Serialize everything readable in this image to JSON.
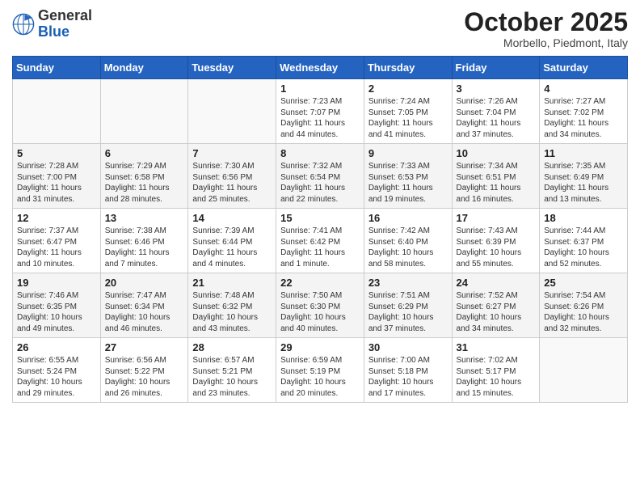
{
  "header": {
    "logo": {
      "general": "General",
      "blue": "Blue"
    },
    "title": "October 2025",
    "location": "Morbello, Piedmont, Italy"
  },
  "weekdays": [
    "Sunday",
    "Monday",
    "Tuesday",
    "Wednesday",
    "Thursday",
    "Friday",
    "Saturday"
  ],
  "weeks": [
    [
      {
        "day": "",
        "info": ""
      },
      {
        "day": "",
        "info": ""
      },
      {
        "day": "",
        "info": ""
      },
      {
        "day": "1",
        "info": "Sunrise: 7:23 AM\nSunset: 7:07 PM\nDaylight: 11 hours\nand 44 minutes."
      },
      {
        "day": "2",
        "info": "Sunrise: 7:24 AM\nSunset: 7:05 PM\nDaylight: 11 hours\nand 41 minutes."
      },
      {
        "day": "3",
        "info": "Sunrise: 7:26 AM\nSunset: 7:04 PM\nDaylight: 11 hours\nand 37 minutes."
      },
      {
        "day": "4",
        "info": "Sunrise: 7:27 AM\nSunset: 7:02 PM\nDaylight: 11 hours\nand 34 minutes."
      }
    ],
    [
      {
        "day": "5",
        "info": "Sunrise: 7:28 AM\nSunset: 7:00 PM\nDaylight: 11 hours\nand 31 minutes."
      },
      {
        "day": "6",
        "info": "Sunrise: 7:29 AM\nSunset: 6:58 PM\nDaylight: 11 hours\nand 28 minutes."
      },
      {
        "day": "7",
        "info": "Sunrise: 7:30 AM\nSunset: 6:56 PM\nDaylight: 11 hours\nand 25 minutes."
      },
      {
        "day": "8",
        "info": "Sunrise: 7:32 AM\nSunset: 6:54 PM\nDaylight: 11 hours\nand 22 minutes."
      },
      {
        "day": "9",
        "info": "Sunrise: 7:33 AM\nSunset: 6:53 PM\nDaylight: 11 hours\nand 19 minutes."
      },
      {
        "day": "10",
        "info": "Sunrise: 7:34 AM\nSunset: 6:51 PM\nDaylight: 11 hours\nand 16 minutes."
      },
      {
        "day": "11",
        "info": "Sunrise: 7:35 AM\nSunset: 6:49 PM\nDaylight: 11 hours\nand 13 minutes."
      }
    ],
    [
      {
        "day": "12",
        "info": "Sunrise: 7:37 AM\nSunset: 6:47 PM\nDaylight: 11 hours\nand 10 minutes."
      },
      {
        "day": "13",
        "info": "Sunrise: 7:38 AM\nSunset: 6:46 PM\nDaylight: 11 hours\nand 7 minutes."
      },
      {
        "day": "14",
        "info": "Sunrise: 7:39 AM\nSunset: 6:44 PM\nDaylight: 11 hours\nand 4 minutes."
      },
      {
        "day": "15",
        "info": "Sunrise: 7:41 AM\nSunset: 6:42 PM\nDaylight: 11 hours\nand 1 minute."
      },
      {
        "day": "16",
        "info": "Sunrise: 7:42 AM\nSunset: 6:40 PM\nDaylight: 10 hours\nand 58 minutes."
      },
      {
        "day": "17",
        "info": "Sunrise: 7:43 AM\nSunset: 6:39 PM\nDaylight: 10 hours\nand 55 minutes."
      },
      {
        "day": "18",
        "info": "Sunrise: 7:44 AM\nSunset: 6:37 PM\nDaylight: 10 hours\nand 52 minutes."
      }
    ],
    [
      {
        "day": "19",
        "info": "Sunrise: 7:46 AM\nSunset: 6:35 PM\nDaylight: 10 hours\nand 49 minutes."
      },
      {
        "day": "20",
        "info": "Sunrise: 7:47 AM\nSunset: 6:34 PM\nDaylight: 10 hours\nand 46 minutes."
      },
      {
        "day": "21",
        "info": "Sunrise: 7:48 AM\nSunset: 6:32 PM\nDaylight: 10 hours\nand 43 minutes."
      },
      {
        "day": "22",
        "info": "Sunrise: 7:50 AM\nSunset: 6:30 PM\nDaylight: 10 hours\nand 40 minutes."
      },
      {
        "day": "23",
        "info": "Sunrise: 7:51 AM\nSunset: 6:29 PM\nDaylight: 10 hours\nand 37 minutes."
      },
      {
        "day": "24",
        "info": "Sunrise: 7:52 AM\nSunset: 6:27 PM\nDaylight: 10 hours\nand 34 minutes."
      },
      {
        "day": "25",
        "info": "Sunrise: 7:54 AM\nSunset: 6:26 PM\nDaylight: 10 hours\nand 32 minutes."
      }
    ],
    [
      {
        "day": "26",
        "info": "Sunrise: 6:55 AM\nSunset: 5:24 PM\nDaylight: 10 hours\nand 29 minutes."
      },
      {
        "day": "27",
        "info": "Sunrise: 6:56 AM\nSunset: 5:22 PM\nDaylight: 10 hours\nand 26 minutes."
      },
      {
        "day": "28",
        "info": "Sunrise: 6:57 AM\nSunset: 5:21 PM\nDaylight: 10 hours\nand 23 minutes."
      },
      {
        "day": "29",
        "info": "Sunrise: 6:59 AM\nSunset: 5:19 PM\nDaylight: 10 hours\nand 20 minutes."
      },
      {
        "day": "30",
        "info": "Sunrise: 7:00 AM\nSunset: 5:18 PM\nDaylight: 10 hours\nand 17 minutes."
      },
      {
        "day": "31",
        "info": "Sunrise: 7:02 AM\nSunset: 5:17 PM\nDaylight: 10 hours\nand 15 minutes."
      },
      {
        "day": "",
        "info": ""
      }
    ]
  ]
}
